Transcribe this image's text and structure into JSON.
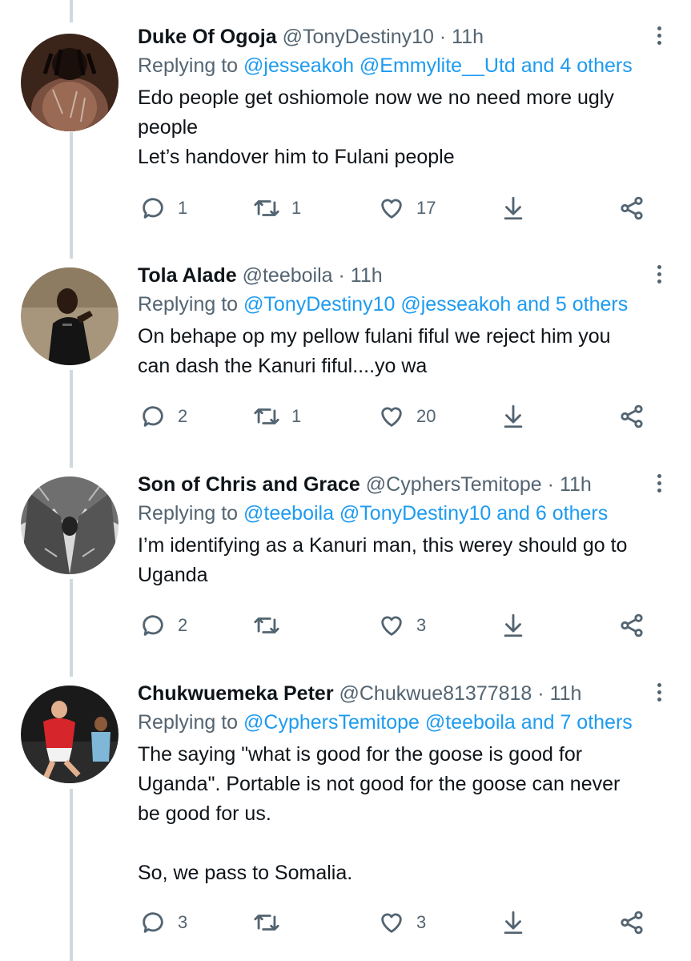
{
  "tweets": [
    {
      "name": "Duke Of Ogoja",
      "handle": "@TonyDestiny10",
      "time": "· 11h",
      "replying_prefix": "Replying to",
      "replying_mentions": "@jesseakoh @Emmylite__Utd and 4 others",
      "body": [
        "Edo people get oshiomole now we no need more ugly",
        "people",
        "Let’s handover him to Fulani people"
      ],
      "replies": "1",
      "retweets": "1",
      "likes": "17"
    },
    {
      "name": "Tola Alade",
      "handle": "@teeboila",
      "time": "· 11h",
      "replying_prefix": "Replying to",
      "replying_mentions": "@TonyDestiny10 @jesseakoh and 5 others",
      "body": [
        "On behape op my pellow fulani fiful we reject him you",
        "can dash the Kanuri fiful....yo wa"
      ],
      "replies": "2",
      "retweets": "1",
      "likes": "20"
    },
    {
      "name": "Son of Chris and Grace",
      "handle": "@CyphersTemitope",
      "time": "· 11h",
      "replying_prefix": "Replying to",
      "replying_mentions": "@teeboila @TonyDestiny10 and 6 others",
      "body": [
        "I’m identifying as a Kanuri man, this  werey should go to",
        "Uganda"
      ],
      "replies": "2",
      "retweets": "",
      "likes": "3"
    },
    {
      "name": "Chukwuemeka Peter",
      "handle": "@Chukwue81377818",
      "time": "· 11h",
      "replying_prefix": "Replying to",
      "replying_mentions": "@CyphersTemitope @teeboila and 7 others",
      "body": [
        "The saying \"what is good for the goose is good for",
        "Uganda\". Portable is not good for the goose can never",
        "be good for us.",
        "",
        "So, we pass to Somalia."
      ],
      "replies": "3",
      "retweets": "",
      "likes": "3"
    }
  ],
  "icons": {
    "reply": "reply-icon",
    "retweet": "retweet-icon",
    "like": "heart-icon",
    "save": "download-icon",
    "share": "share-icon",
    "more": "more-icon"
  },
  "colors": {
    "text": "#0f1419",
    "secondary": "#536471",
    "mention": "#1d9bf0",
    "thread_line": "#cfd9de"
  }
}
